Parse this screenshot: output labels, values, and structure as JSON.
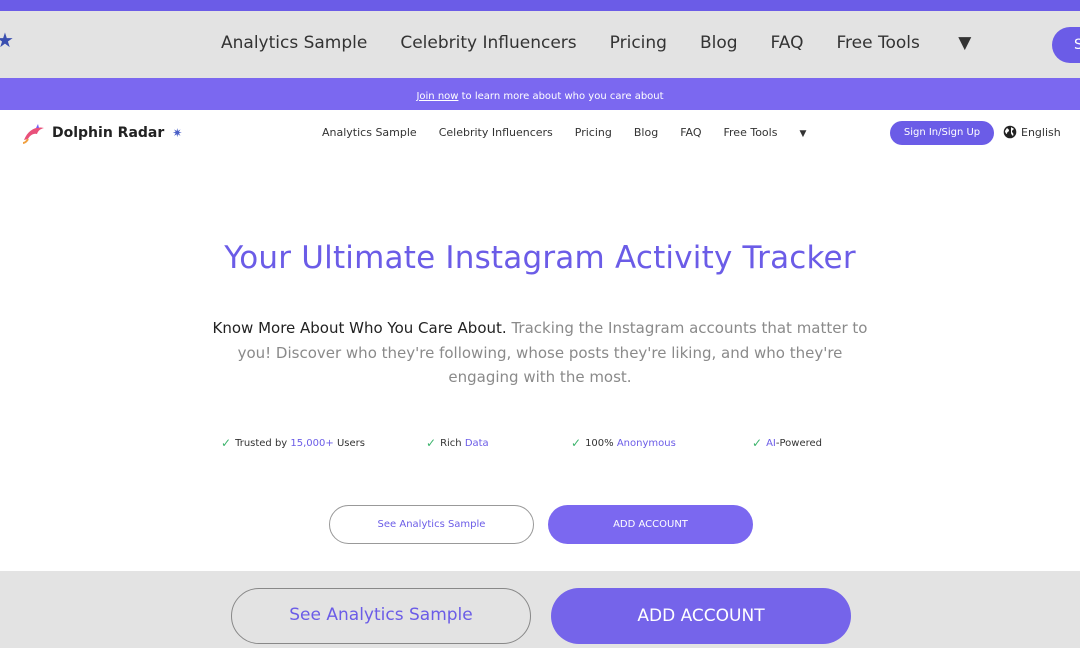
{
  "background_nav": {
    "links": [
      "Analytics Sample",
      "Celebrity Influencers",
      "Pricing",
      "Blog",
      "FAQ",
      "Free Tools"
    ],
    "button_label": "S"
  },
  "banner": {
    "join_link": "Join now",
    "rest_text": " to learn more about who you care about"
  },
  "header": {
    "logo_text": "Dolphin Radar",
    "nav": {
      "analytics_sample": "Analytics Sample",
      "celebrity_influencers": "Celebrity Influencers",
      "pricing": "Pricing",
      "blog": "Blog",
      "faq": "FAQ",
      "free_tools": "Free Tools"
    },
    "signin_label": "Sign In/Sign Up",
    "language": "English"
  },
  "hero": {
    "title": "Your Ultimate Instagram Activity Tracker",
    "desc_lead": "Know More About Who You Care About.",
    "desc_rest": " Tracking the Instagram accounts that matter to you! Discover who they're following, whose posts they're liking, and who they're engaging with the most."
  },
  "features": [
    {
      "pre": "Trusted by ",
      "hl": "15,000+",
      "post": " Users"
    },
    {
      "pre": "Rich ",
      "hl": "Data",
      "post": ""
    },
    {
      "pre": "100% ",
      "hl": "Anonymous",
      "post": ""
    },
    {
      "pre": "",
      "hl": "AI",
      "post": "-Powered"
    }
  ],
  "buttons": {
    "see_sample": "See Analytics Sample",
    "add_account": "ADD ACCOUNT"
  },
  "background_buttons": {
    "see_sample": "See Analytics Sample",
    "add_account": "ADD ACCOUNT"
  },
  "colors": {
    "brand": "#6b5ce7",
    "check": "#3db46d"
  }
}
